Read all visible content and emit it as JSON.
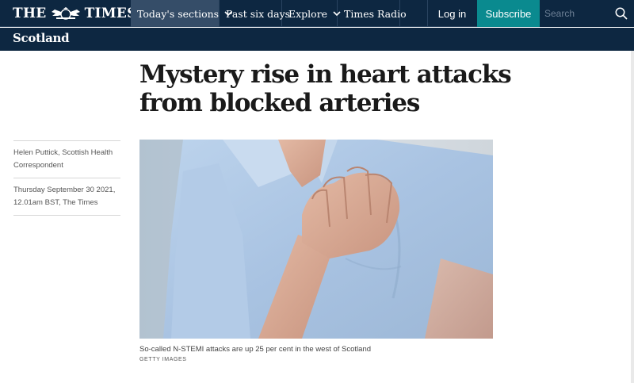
{
  "masthead": {
    "logo_left": "THE",
    "logo_right": "TIMES",
    "logo_icon": "royal-crest-icon"
  },
  "nav": {
    "items": [
      {
        "label": "Today's sections",
        "has_dropdown": true,
        "active": true
      },
      {
        "label": "Past six days",
        "has_dropdown": false,
        "active": false
      },
      {
        "label": "Explore",
        "has_dropdown": true,
        "active": false
      },
      {
        "label": "Times Radio",
        "has_dropdown": false,
        "active": false
      }
    ],
    "login_label": "Log in",
    "subscribe_label": "Subscribe",
    "search_placeholder": "Search",
    "search_icon": "search-icon"
  },
  "section": {
    "title": "Scotland"
  },
  "article": {
    "headline": "Mystery rise in heart attacks from blocked arteries",
    "author": "Helen Puttick, Scottish Health Correspondent",
    "dateline": "Thursday September 30 2021, 12.01am BST, The Times",
    "image_caption": "So-called N-STEMI attacks are up 25 per cent in the west of Scotland",
    "image_credit": "GETTY IMAGES"
  },
  "colors": {
    "nav_background": "#0d2741",
    "nav_active": "#354d68",
    "subscribe": "#0a8a8f",
    "shirt": "#a9c3e2"
  }
}
